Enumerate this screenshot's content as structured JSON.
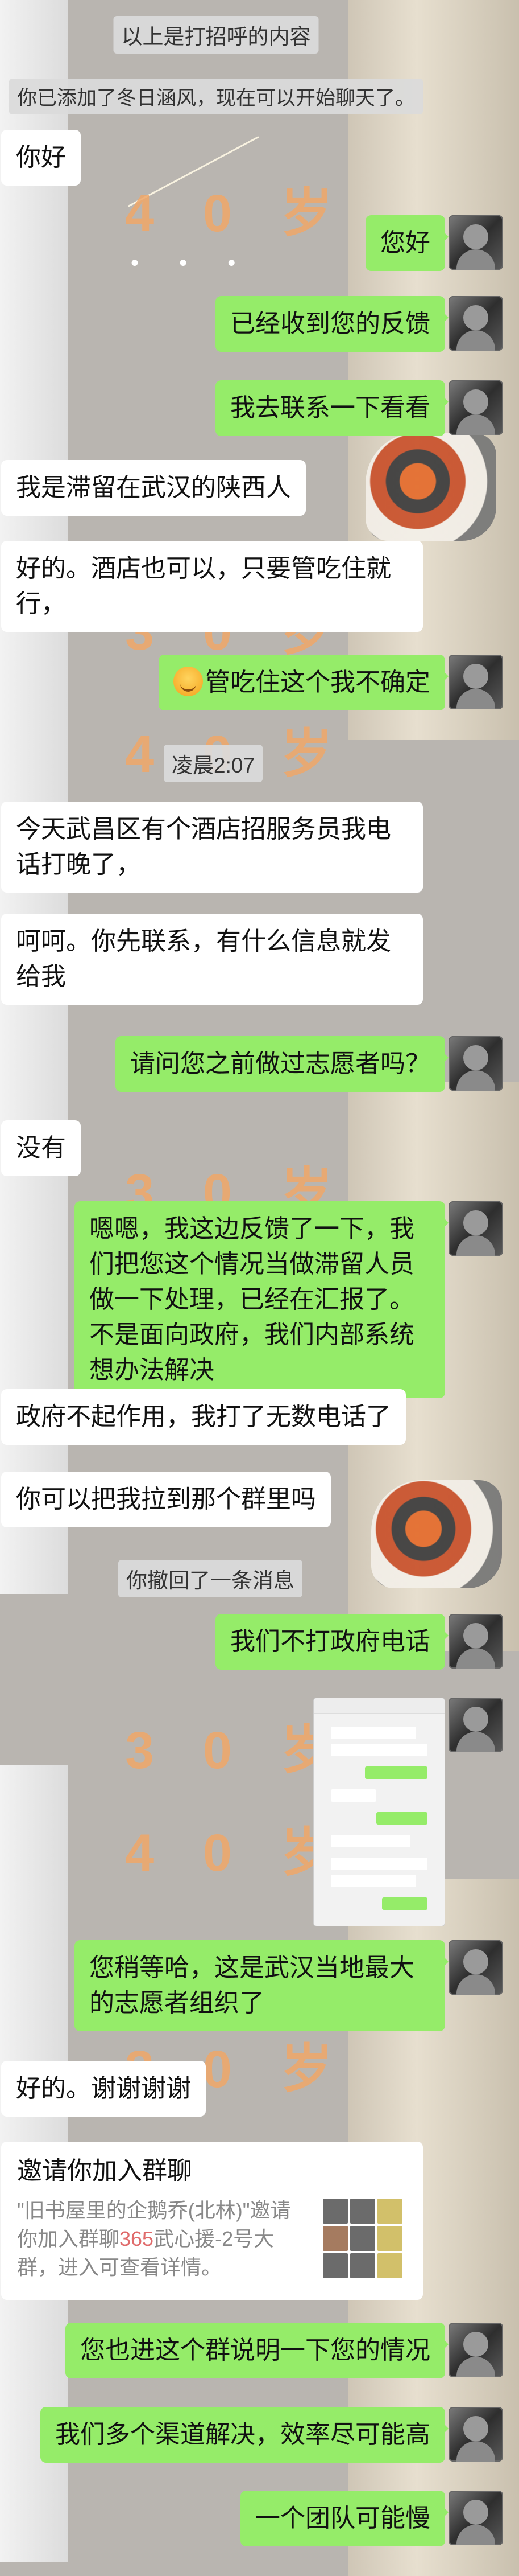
{
  "system_notices": {
    "greeting_note": "以上是打招呼的内容",
    "added_friend": "你已添加了冬日涵风，现在可以开始聊天了。",
    "time_stamp": "凌晨2:07",
    "recalled": "你撤回了一条消息"
  },
  "wallpaper": {
    "age_30": "3 0 岁",
    "age_40": "4 0 岁",
    "dots": "• • •"
  },
  "messages": {
    "m1": "你好",
    "m2": "您好",
    "m3": "已经收到您的反馈",
    "m4": "我去联系一下看看",
    "m5": "我是滞留在武汉的陕西人",
    "m6": "好的。酒店也可以，只要管吃住就行，",
    "m7": "管吃住这个我不确定",
    "m8": "今天武昌区有个酒店招服务员我电话打晚了，",
    "m9": "呵呵。你先联系，有什么信息就发给我",
    "m10": "请问您之前做过志愿者吗？",
    "m11": "没有",
    "m12": "嗯嗯，我这边反馈了一下，我们把您这个情况当做滞留人员做一下处理，已经在汇报了。不是面向政府，我们内部系统想办法解决",
    "m13": "政府不起作用，我打了无数电话了",
    "m14": "你可以把我拉到那个群里吗",
    "m15": "我们不打政府电话",
    "m16": "您稍等哈，这是武汉当地最大的志愿者组织了",
    "m17": "好的。谢谢谢谢",
    "m18": "您也进这个群说明一下您的情况",
    "m19": "我们多个渠道解决，效率尽可能高",
    "m20": "一个团队可能慢"
  },
  "invite_card": {
    "title": "邀请你加入群聊",
    "desc_before": "\"旧书屋里的企鹅乔(北林)\"邀请你加入群聊",
    "desc_highlight": "365",
    "desc_after": "武心援-2号大群，进入可查看详情。"
  },
  "icons": {
    "avatar": "avatar-icon",
    "emoji": "laugh-cry-emoji-icon",
    "group_avatar": "group-avatar-grid-icon"
  },
  "colors": {
    "outgoing_bubble": "#95ec69",
    "incoming_bubble": "#ffffff",
    "wallpaper_text": "#f0a869"
  }
}
